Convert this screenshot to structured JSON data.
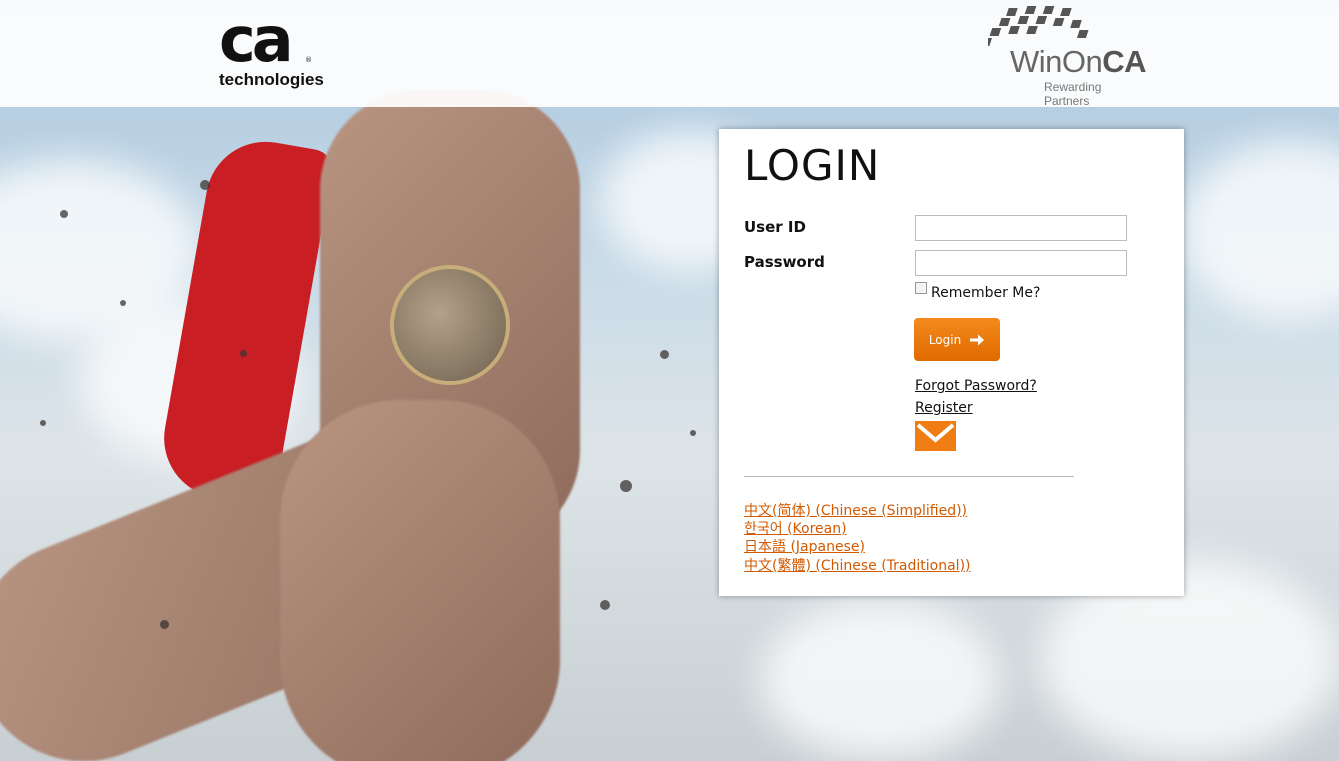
{
  "header": {
    "ca_mark": "ca",
    "ca_sub": "technologies",
    "ca_reg": "®",
    "partner_name_light": "WinOn",
    "partner_name_bold": "CA",
    "partner_tagline": "Rewarding Partners"
  },
  "login": {
    "title": "LOGIN",
    "user_id_label": "User ID",
    "user_id_value": "",
    "password_label": "Password",
    "password_value": "",
    "remember_label": "Remember Me?",
    "remember_checked": false,
    "login_button": "Login",
    "forgot_password": "Forgot Password?",
    "register": "Register"
  },
  "languages": [
    "中文(简体) (Chinese (Simplified))",
    "한국어 (Korean)",
    "日本語 (Japanese)",
    "中文(繁體) (Chinese (Traditional))"
  ],
  "colors": {
    "accent": "#f07d14",
    "link": "#d25a00"
  },
  "icons": [
    "arrow-right-icon",
    "envelope-icon"
  ]
}
